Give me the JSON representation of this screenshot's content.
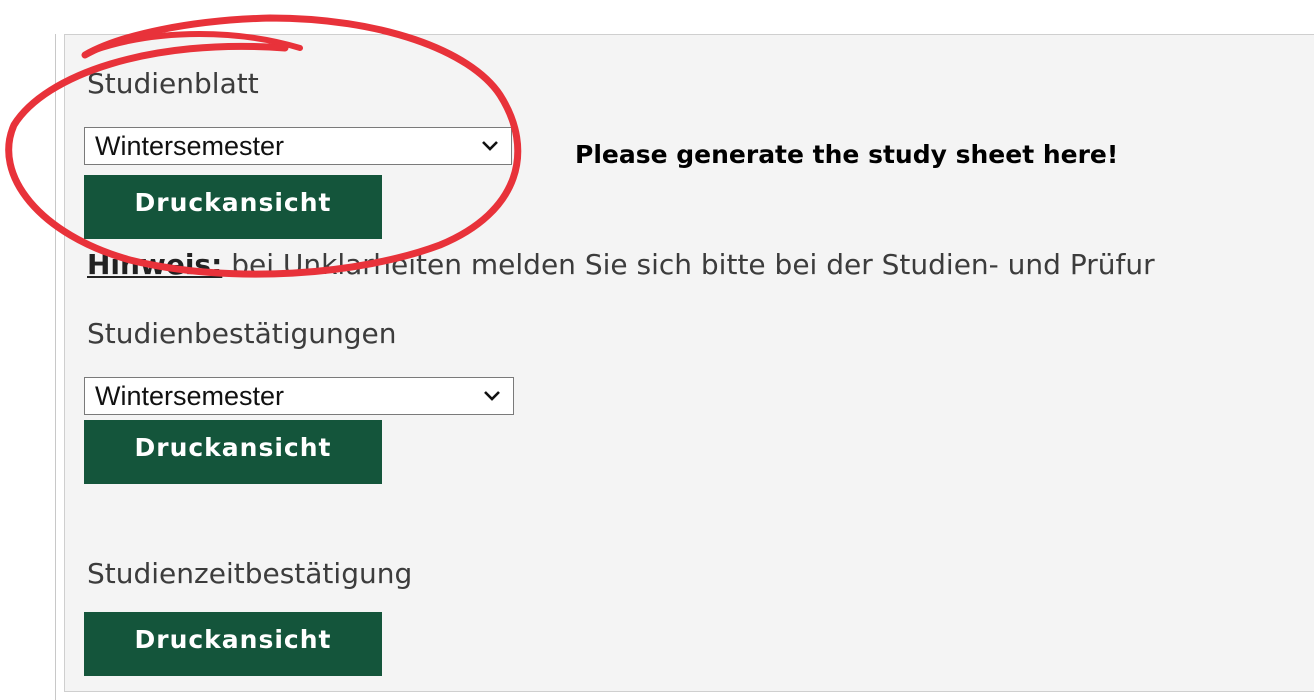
{
  "studienblatt": {
    "title": "Studienblatt",
    "select_value": "Wintersemester",
    "print_label": "Druckansicht"
  },
  "hint": {
    "label": "Hinweis:",
    "text": " bei Unklarheiten melden Sie sich bitte bei der Studien- und Prüfur"
  },
  "studienbestaetigungen": {
    "title": "Studienbestätigungen",
    "select_value": "Wintersemester",
    "print_label": "Druckansicht"
  },
  "studienzeitbestaetigung": {
    "title": "Studienzeitbestätigung",
    "print_label": "Druckansicht"
  },
  "annotation": {
    "note": "Please generate the study sheet here!",
    "circle_color": "#e8323a"
  },
  "colors": {
    "button_bg": "#14553b",
    "panel_bg": "#f4f4f4"
  }
}
